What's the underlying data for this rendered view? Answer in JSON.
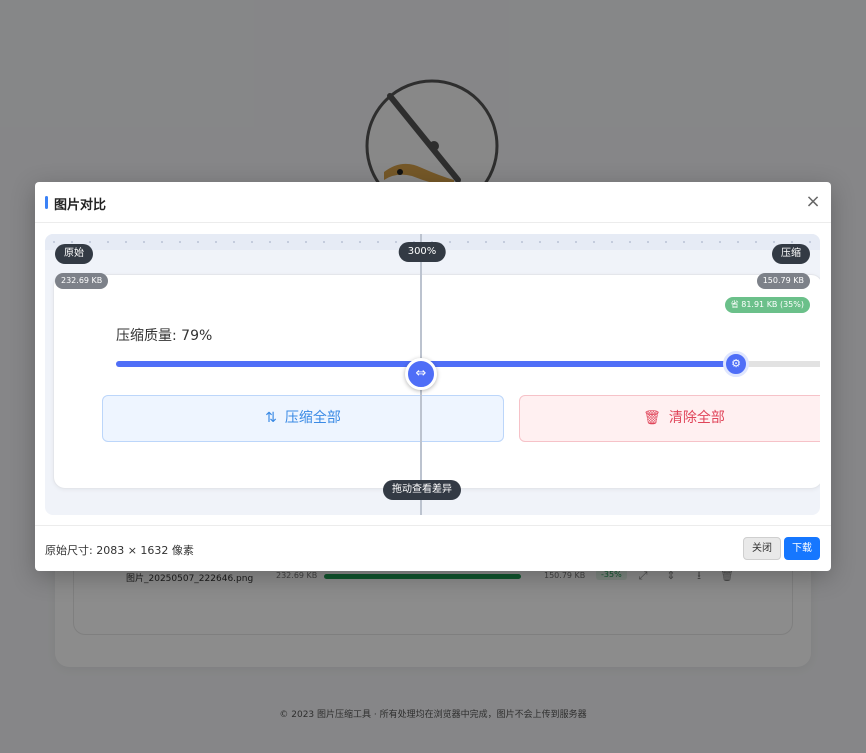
{
  "modal": {
    "title": "图片对比",
    "close_icon": "×",
    "compare": {
      "zoom": "300%",
      "label_original": "原始",
      "label_compressed": "压缩",
      "original_size": "232.69 KB",
      "compressed_size": "150.79 KB",
      "saved": "省 81.91 KB (35%)",
      "drag_hint": "拖动查看差异",
      "divider_position_fraction": 0.485,
      "preview": {
        "quality_label": "压缩质量: 79%",
        "quality_value": 0.79,
        "compress_all": "压缩全部",
        "clear_all": "清除全部",
        "compress_icon": "compress-icon",
        "trash_icon": "trash-icon"
      }
    },
    "footer": {
      "dimensions": "原始尺寸: 2083 × 1632 像素",
      "close_button": "关闭",
      "download_button": "下载"
    }
  },
  "background": {
    "file_row": {
      "name": "图片_20250507_222646.png",
      "original_size": "232.69 KB",
      "compressed_size": "150.79 KB",
      "percent": "-35%",
      "progress": 1.0
    },
    "footer": "© 2023 图片压缩工具 · 所有处理均在浏览器中完成，图片不会上传到服务器"
  },
  "colors": {
    "accent": "#4f6ef7",
    "primary_button": "#1677ff",
    "danger": "#e0455a",
    "success": "#1f9d55"
  }
}
